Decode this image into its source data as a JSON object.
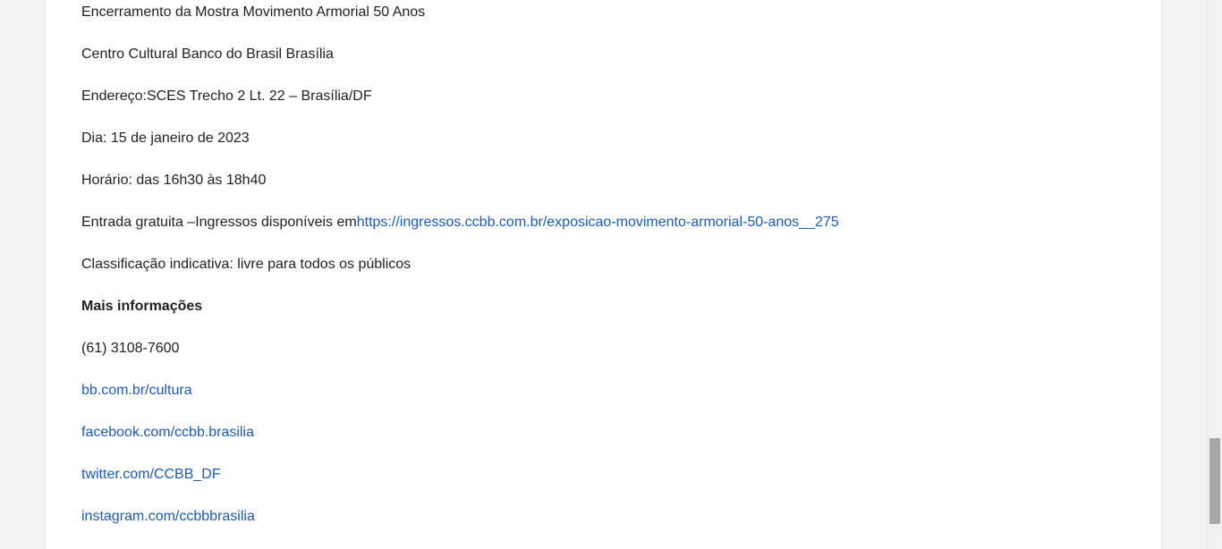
{
  "event": {
    "closing_title": "Encerramento da Mostra Movimento Armorial 50 Anos",
    "venue": "Centro Cultural Banco do Brasil Brasília",
    "address": "Endereço:SCES Trecho 2 Lt. 22 – Brasília/DF",
    "date": "Dia: 15 de janeiro de 2023",
    "time": "Horário: das 16h30 às 18h40",
    "entry_prefix": "Entrada gratuita –Ingressos disponíveis em",
    "entry_link": "https://ingressos.ccbb.com.br/exposicao-movimento-armorial-50-anos__275",
    "rating": "Classificação indicativa: livre para todos os públicos"
  },
  "more_info": {
    "heading": "Mais informações",
    "phone": "(61) 3108-7600",
    "links": {
      "site": "bb.com.br/cultura",
      "facebook": "facebook.com/ccbb.brasilia",
      "twitter": "twitter.com/CCBB_DF",
      "instagram": "instagram.com/ccbbbrasilia"
    }
  },
  "colors": {
    "link": "#1c5bb8",
    "text": "#1f1f1f",
    "background": "#f1f1f1",
    "card": "#ffffff"
  }
}
